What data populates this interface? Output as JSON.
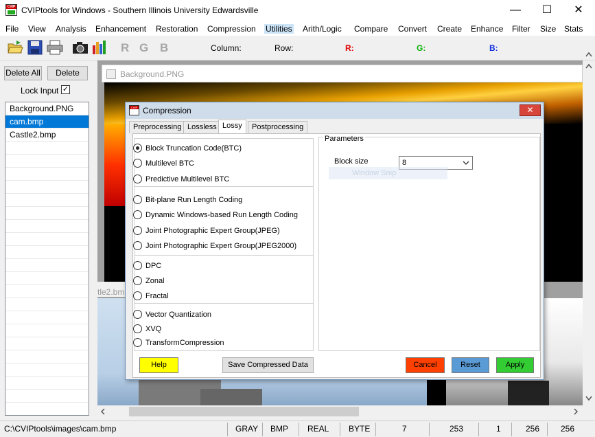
{
  "window": {
    "title": "CVIPtools for Windows - Southern Illinois University Edwardsville",
    "app_icon_text": "CVIP",
    "minimize_glyph": "—",
    "maximize_glyph": "☐",
    "close_glyph": "✕"
  },
  "menu": [
    "File",
    "View",
    "Analysis",
    "Enhancement",
    "Restoration",
    "Compression",
    "Utilities",
    "Arith/Logic",
    "Compare",
    "Convert",
    "Create",
    "Enhance",
    "Filter",
    "Size",
    "Stats"
  ],
  "menu_active": "Utilities",
  "toolbar": {
    "icons": [
      "open-folder-icon",
      "save-icon",
      "print-icon",
      "camera-icon",
      "histogram-icon"
    ],
    "rgb": [
      "R",
      "G",
      "B"
    ],
    "column_label": "Column:",
    "row_label": "Row:",
    "r_label": "R:",
    "g_label": "G:",
    "b_label": "B:",
    "colors": {
      "r": "#e00000",
      "g": "#10b010",
      "b": "#1030e0"
    }
  },
  "left_panel": {
    "delete_all": "Delete All",
    "delete": "Delete",
    "lock_input": "Lock Input",
    "lock_checked": true,
    "images": [
      "Background.PNG",
      "cam.bmp",
      "Castle2.bmp"
    ],
    "selected": "cam.bmp"
  },
  "mdi": {
    "background_window_title": "Background.PNG",
    "castle_window_title_fragment": "tle2.bmp",
    "ghost_text": "Window Snip"
  },
  "dialog": {
    "title": "Compression",
    "icon_text": "CVIP",
    "close_glyph": "✕",
    "tabs": [
      "Preprocessing",
      "Lossless",
      "Lossy",
      "Postprocessing"
    ],
    "active_tab": "Lossy",
    "options": [
      {
        "label": "Block Truncation Code(BTC)",
        "checked": true
      },
      {
        "label": "Multilevel BTC",
        "checked": false
      },
      {
        "label": "Predictive Multilevel BTC",
        "checked": false
      },
      {
        "label": "Bit-plane Run Length Coding",
        "checked": false
      },
      {
        "label": "Dynamic Windows-based Run Length Coding",
        "checked": false
      },
      {
        "label": "Joint Photographic Expert Group(JPEG)",
        "checked": false
      },
      {
        "label": "Joint Photographic Expert Group(JPEG2000)",
        "checked": false
      },
      {
        "label": "DPC",
        "checked": false
      },
      {
        "label": "Zonal",
        "checked": false
      },
      {
        "label": "Fractal",
        "checked": false
      },
      {
        "label": "Vector Quantization",
        "checked": false
      },
      {
        "label": "XVQ",
        "checked": false
      },
      {
        "label": "TransformCompression",
        "checked": false
      }
    ],
    "parameters": {
      "legend": "Parameters",
      "block_size_label": "Block size",
      "block_size_value": "8"
    },
    "buttons": {
      "help": "Help",
      "save": "Save Compressed Data",
      "cancel": "Cancel",
      "reset": "Reset",
      "apply": "Apply"
    },
    "button_colors": {
      "help": "#ffff00",
      "cancel": "#ff4000",
      "reset": "#5b9bd5",
      "apply": "#33cc33"
    }
  },
  "status": {
    "path": "C:\\CVIPtools\\images\\cam.bmp",
    "color_space": "GRAY",
    "format": "BMP",
    "data_format": "REAL",
    "data_type": "BYTE",
    "bands": "7",
    "value": "253",
    "bands2": "1",
    "width": "256",
    "height": "256"
  }
}
